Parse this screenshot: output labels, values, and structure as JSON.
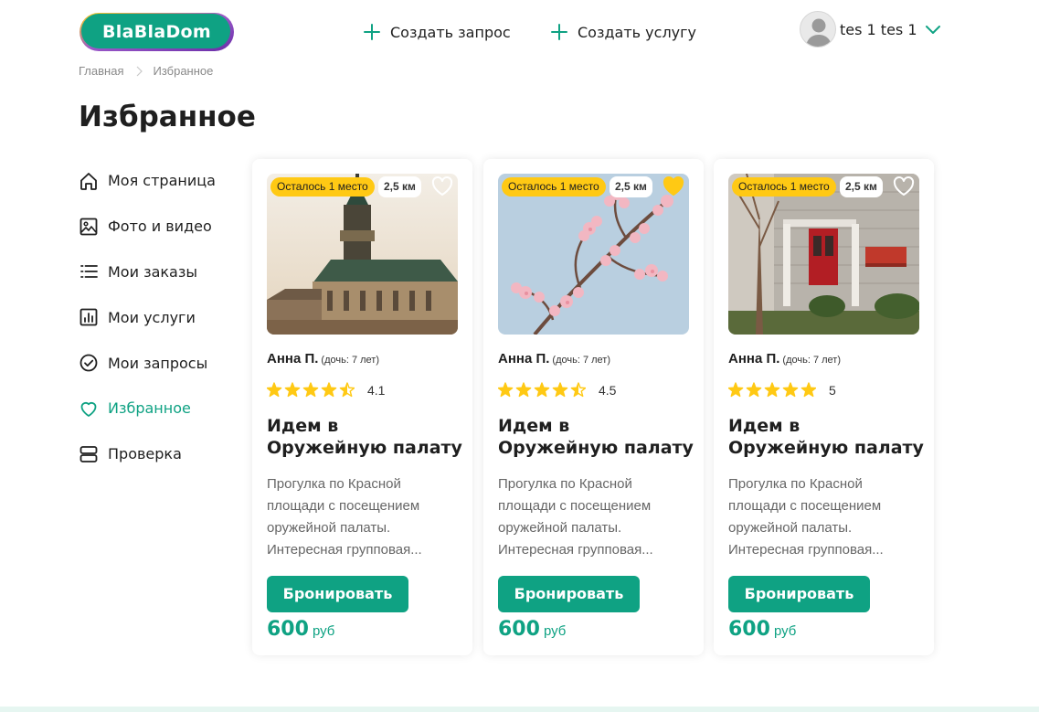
{
  "header": {
    "logo_text": "BlaBlaDom",
    "create_request": "Создать запрос",
    "create_service": "Создать услугу",
    "user_name": "tes 1 tes 1"
  },
  "breadcrumb": {
    "home": "Главная",
    "current": "Избранное"
  },
  "page_title": "Избранное",
  "sidebar": {
    "items": [
      {
        "label": "Моя страница",
        "icon": "home-icon"
      },
      {
        "label": "Фото и видео",
        "icon": "image-icon"
      },
      {
        "label": "Мои заказы",
        "icon": "list-icon"
      },
      {
        "label": "Мои услуги",
        "icon": "chart-icon"
      },
      {
        "label": "Мои запросы",
        "icon": "check-circle-icon"
      },
      {
        "label": "Избранное",
        "icon": "heart-icon",
        "active": true
      },
      {
        "label": "Проверка",
        "icon": "server-icon"
      }
    ]
  },
  "cards": [
    {
      "image": "castle-photo",
      "seats_badge": "Осталось 1 место",
      "distance": "2,5 км",
      "favorite": false,
      "author": "Анна П.",
      "child": "(дочь: 7 лет)",
      "rating": 4.1,
      "rating_text": "4.1",
      "title": "Идем в Оружейную палату",
      "desc_lines": [
        "Прогулка по Красной",
        "площади с посещением",
        "оружейной палаты.",
        "Интересная групповая..."
      ],
      "button": "Бронировать",
      "price": "600",
      "currency": "руб"
    },
    {
      "image": "blossom-photo",
      "seats_badge": "Осталось 1 место",
      "distance": "2,5 км",
      "favorite": true,
      "author": "Анна П.",
      "child": "(дочь: 7 лет)",
      "rating": 4.5,
      "rating_text": "4.5",
      "title": "Идем в Оружейную палату",
      "desc_lines": [
        "Прогулка по Красной",
        "площади с посещением",
        "оружейной палаты.",
        "Интересная групповая..."
      ],
      "button": "Бронировать",
      "price": "600",
      "currency": "руб"
    },
    {
      "image": "house-photo",
      "seats_badge": "Осталось 1 место",
      "distance": "2,5 км",
      "favorite": false,
      "author": "Анна П.",
      "child": "(дочь: 7 лет)",
      "rating": 5,
      "rating_text": "5",
      "title": "Идем в Оружейную палату",
      "desc_lines": [
        "Прогулка по Красной",
        "площади с посещением",
        "оружейной палаты.",
        "Интересная групповая..."
      ],
      "button": "Бронировать",
      "price": "600",
      "currency": "руб"
    }
  ],
  "colors": {
    "accent": "#0fa283",
    "badge": "#ffc914",
    "star": "#ffc914",
    "text": "#1f1f1f"
  }
}
